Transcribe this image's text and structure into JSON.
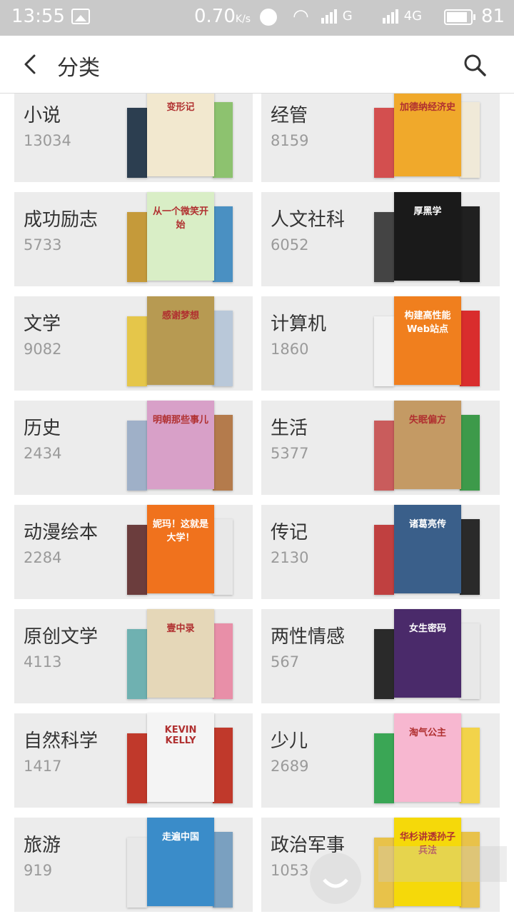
{
  "status_bar": {
    "time": "13:55",
    "speed": "0.70",
    "speed_unit": "K/s",
    "sim1_type": "G",
    "sim2_type": "4G",
    "battery": "81"
  },
  "header": {
    "title": "分类"
  },
  "categories": [
    {
      "name": "小说",
      "count": "13034",
      "colors": [
        "#2c3e50",
        "#f2e8cf",
        "#8dc26f"
      ]
    },
    {
      "name": "经管",
      "count": "8159",
      "colors": [
        "#d34f4f",
        "#f0a92b",
        "#f0e9d8"
      ]
    },
    {
      "name": "成功励志",
      "count": "5733",
      "colors": [
        "#c59a3a",
        "#d9eec6",
        "#4a90c2"
      ]
    },
    {
      "name": "人文社科",
      "count": "6052",
      "colors": [
        "#444444",
        "#1a1a1a",
        "#202020"
      ]
    },
    {
      "name": "文学",
      "count": "9082",
      "colors": [
        "#e5c64a",
        "#b79a52",
        "#b9c8d9"
      ]
    },
    {
      "name": "计算机",
      "count": "1860",
      "colors": [
        "#f2f2f2",
        "#f07f1e",
        "#d92d2d"
      ]
    },
    {
      "name": "历史",
      "count": "2434",
      "colors": [
        "#9fb0c8",
        "#d8a0c8",
        "#b47b4c"
      ]
    },
    {
      "name": "生活",
      "count": "5377",
      "colors": [
        "#c95c5c",
        "#c49a64",
        "#3d9a4a"
      ]
    },
    {
      "name": "动漫绘本",
      "count": "2284",
      "colors": [
        "#6b3d3d",
        "#f0721d",
        "#e8e8e8"
      ]
    },
    {
      "name": "传记",
      "count": "2130",
      "colors": [
        "#c04040",
        "#3a5f8a",
        "#2a2a2a"
      ]
    },
    {
      "name": "原创文学",
      "count": "4113",
      "colors": [
        "#6fb1b1",
        "#e5d7b8",
        "#e88fa8"
      ]
    },
    {
      "name": "两性情感",
      "count": "567",
      "colors": [
        "#2a2a2a",
        "#4a2a6a",
        "#e8e8e8"
      ]
    },
    {
      "name": "自然科学",
      "count": "1417",
      "colors": [
        "#c0392b",
        "#f4f4f4",
        "#c0392b"
      ]
    },
    {
      "name": "少儿",
      "count": "2689",
      "colors": [
        "#3aa655",
        "#f7b7d0",
        "#f2d34a"
      ]
    },
    {
      "name": "旅游",
      "count": "919",
      "colors": [
        "#e8e8e8",
        "#3a8cc9",
        "#7aa0c0"
      ]
    },
    {
      "name": "政治军事",
      "count": "1053",
      "colors": [
        "#e8c24a",
        "#f5d90a",
        "#e8c24a"
      ]
    }
  ],
  "book_titles": {
    "0": "变形记",
    "1": "加德纳经济史",
    "2": "从一个微笑开始",
    "3": "厚黑学",
    "4": "感谢梦想",
    "5": "构建高性能Web站点",
    "6": "明朝那些事儿",
    "7": "失眠偏方",
    "8": "妮玛！这就是大学！",
    "9": "诸葛亮传",
    "10": "壹中录",
    "11": "女生密码",
    "12": "KEVIN KELLY",
    "13": "淘气公主",
    "14": "走遍中国",
    "15": "华杉讲透孙子兵法"
  },
  "icons": {
    "back": "chevron-left-icon",
    "search": "search-icon"
  }
}
